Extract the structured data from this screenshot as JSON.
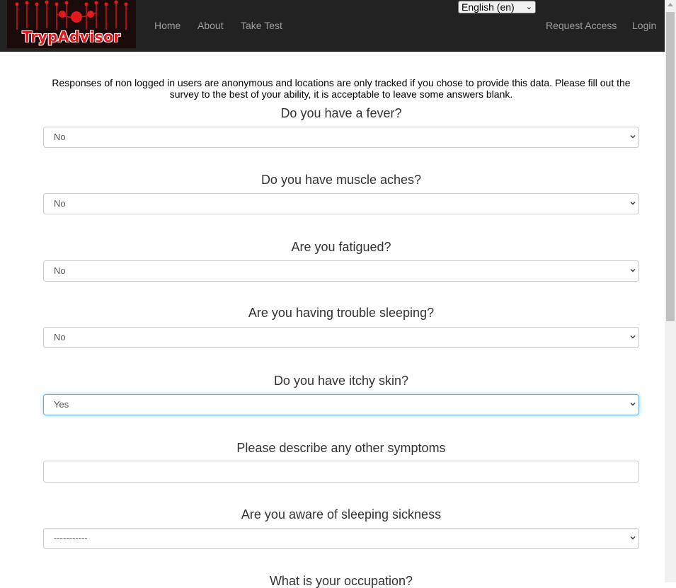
{
  "navbar": {
    "brand": "TrypAdvisor",
    "links": [
      "Home",
      "About",
      "Take Test"
    ],
    "right_links": [
      "Request Access",
      "Login"
    ],
    "language": "English (en)",
    "colors": {
      "background": "#222222",
      "link": "#9d9d9d",
      "brand": "#e8141b"
    }
  },
  "intro": "Responses of non logged in users are anonymous and locations are only tracked if you chose to provide this data. Please fill out the survey to the best of your ability, it is acceptable to leave some answers blank.",
  "questions": [
    {
      "label": "Do you have a fever?",
      "value": "No"
    },
    {
      "label": "Do you have muscle aches?",
      "value": "No"
    },
    {
      "label": "Are you fatigued?",
      "value": "No"
    },
    {
      "label": "Are you having trouble sleeping?",
      "value": "No"
    },
    {
      "label": "Do you have itchy skin?",
      "value": "Yes"
    },
    {
      "label": "Please describe any other symptoms",
      "value": ""
    },
    {
      "label": "Are you aware of sleeping sickness",
      "value": "-----------"
    },
    {
      "label": "What is your occupation?"
    }
  ]
}
